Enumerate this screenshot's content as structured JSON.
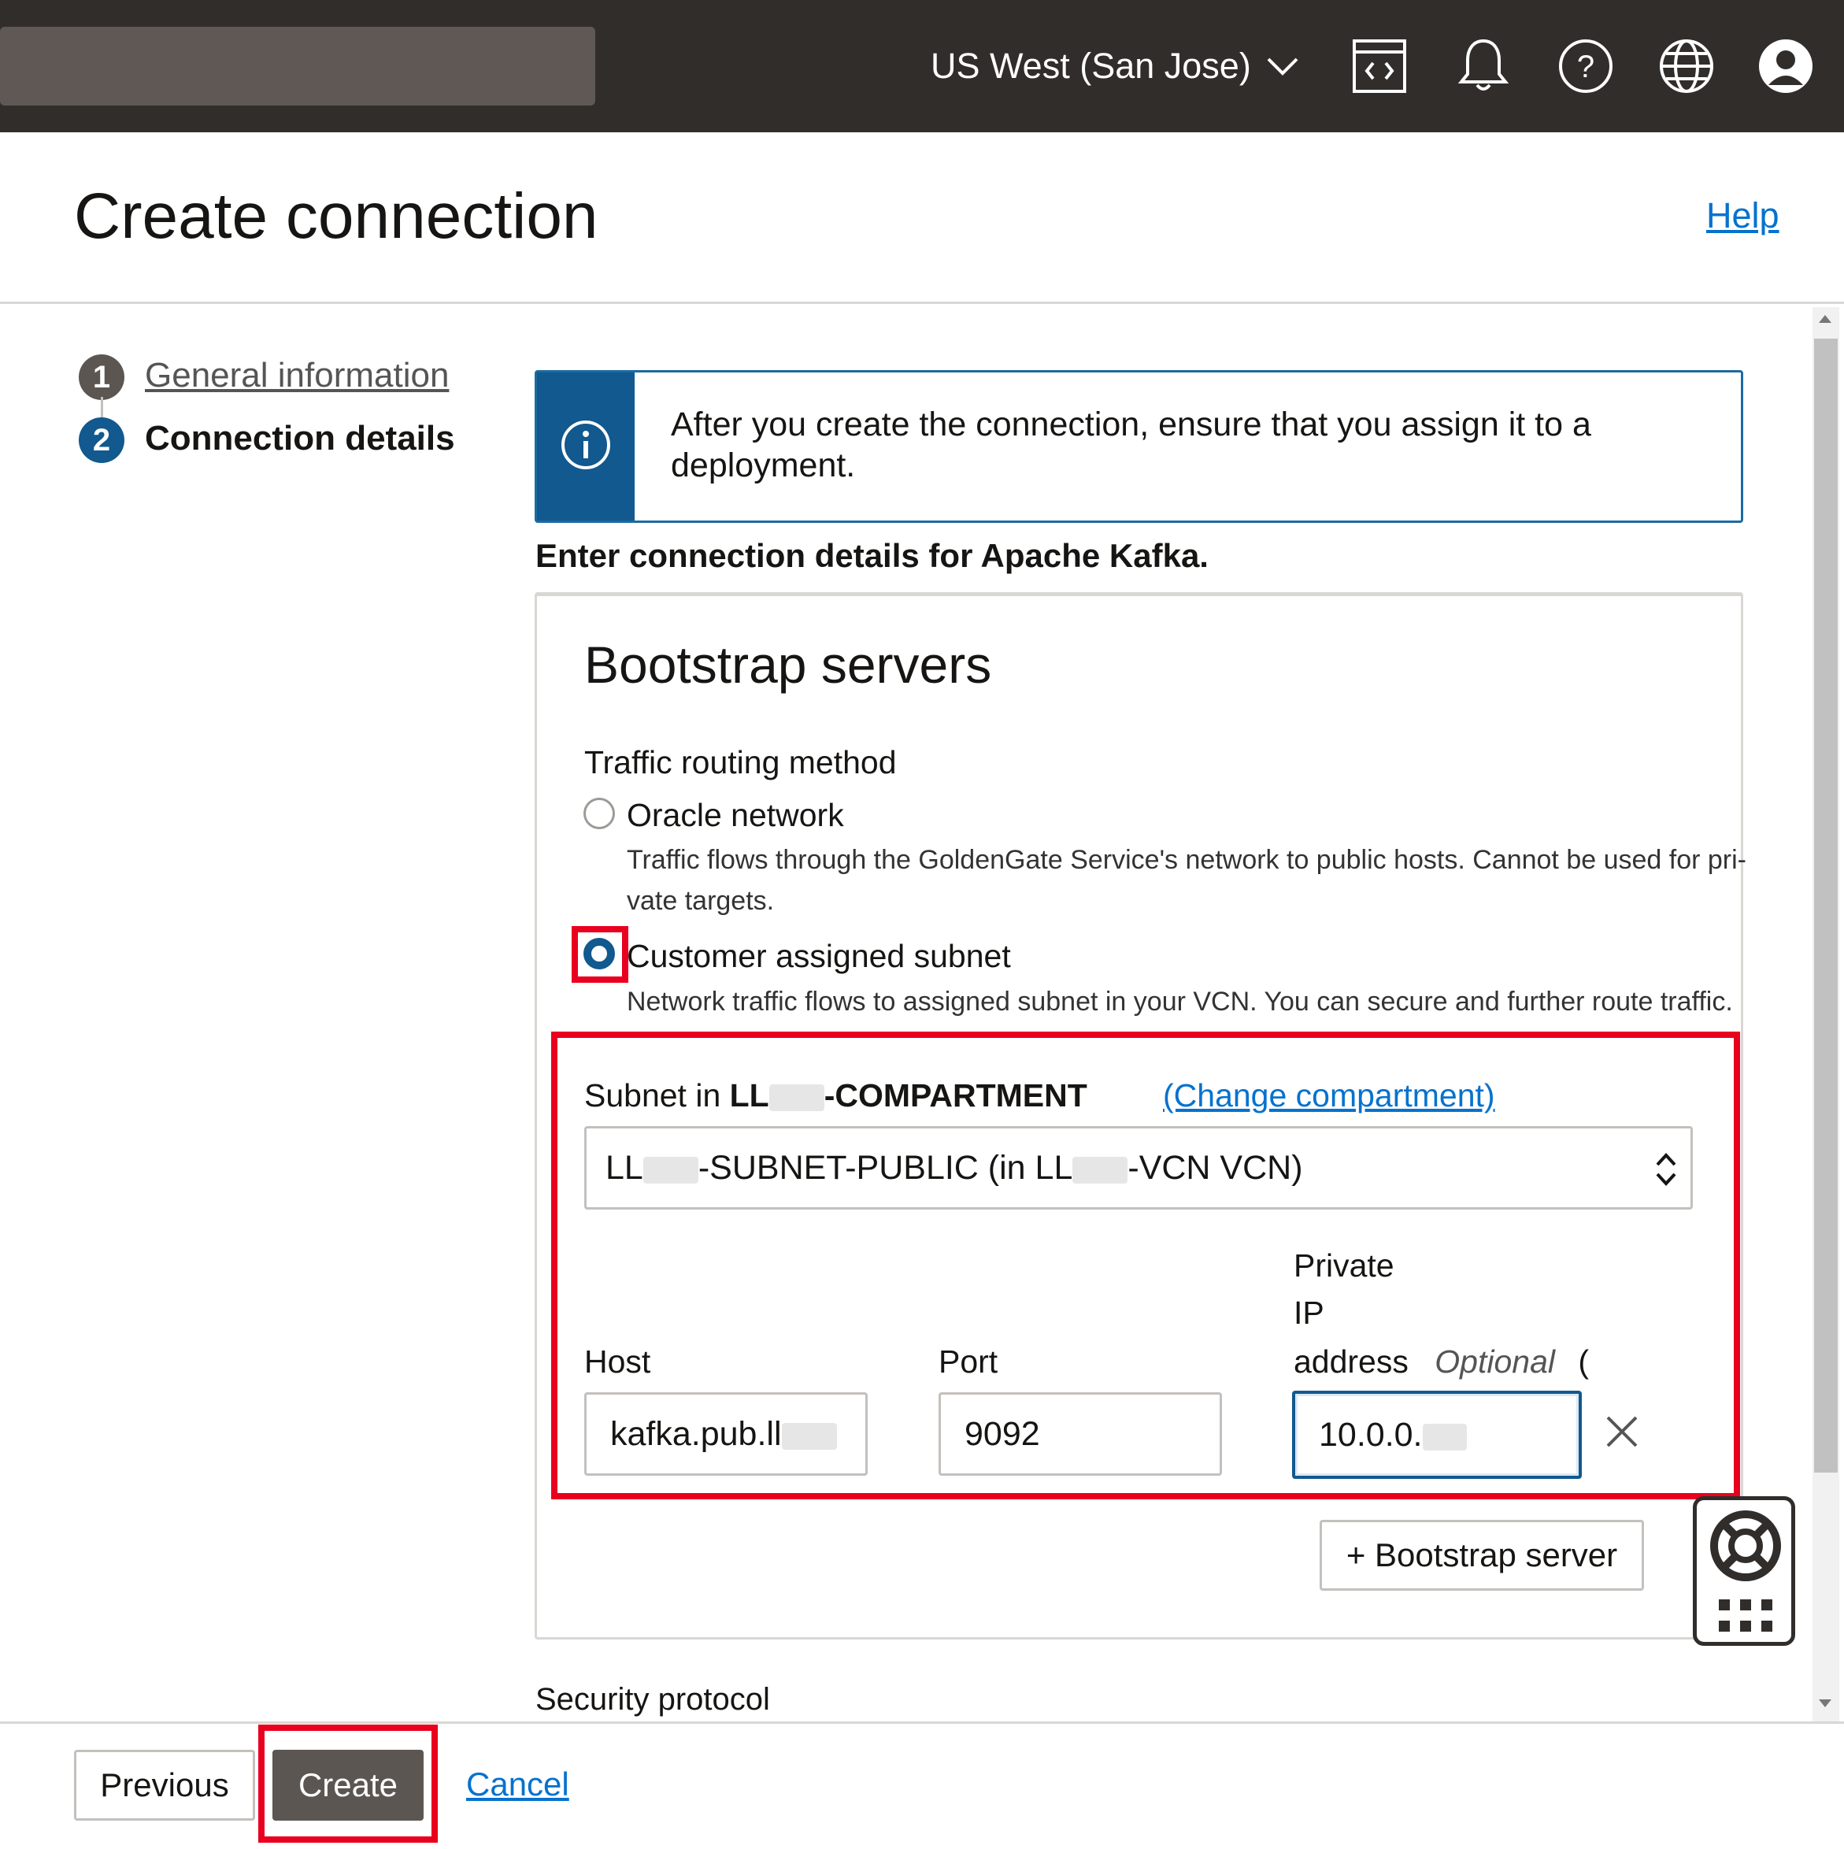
{
  "topbar": {
    "region_label": "US West (San Jose)",
    "icons": [
      "code-editor-icon",
      "bell-icon",
      "help-circle-icon",
      "globe-icon",
      "user-avatar-icon"
    ]
  },
  "header": {
    "title": "Create connection",
    "help_link": "Help"
  },
  "steps": [
    {
      "number": "1",
      "label": "General information"
    },
    {
      "number": "2",
      "label": "Connection details"
    }
  ],
  "info_banner": {
    "text": "After you create the connection, ensure that you assign it to a deployment."
  },
  "section_intro": "Enter connection details for Apache Kafka.",
  "bootstrap": {
    "title": "Bootstrap servers",
    "routing_label": "Traffic routing method",
    "option_oracle": {
      "label": "Oracle network",
      "description_line1": "Traffic flows through the GoldenGate Service's network to public hosts. Cannot be used for pri-",
      "description_line2": "vate targets."
    },
    "option_customer": {
      "label": "Customer assigned subnet",
      "description": "Network traffic flows to assigned subnet in your VCN. You can secure and further route traffic."
    },
    "selected_option": "Customer assigned subnet",
    "subnet_label_prefix": "Subnet in ",
    "subnet_compartment_start": "LL",
    "subnet_compartment_end": "-COMPARTMENT",
    "change_compartment": "(Change compartment)",
    "subnet_select_start": "LL",
    "subnet_select_mid": "-SUBNET-PUBLIC (in LL",
    "subnet_select_end": "-VCN VCN)",
    "host_label": "Host",
    "host_value": "kafka.pub.ll",
    "port_label": "Port",
    "port_value": "9092",
    "private_ip_label_1": "Private",
    "private_ip_label_2": "IP",
    "private_ip_label_3": "address",
    "optional_label": "Optional",
    "optional_paren": "(",
    "private_ip_value": "10.0.0.",
    "add_bootstrap_button": "+ Bootstrap server"
  },
  "security_protocol_label": "Security protocol",
  "footer": {
    "previous": "Previous",
    "create": "Create",
    "cancel": "Cancel"
  },
  "colors": {
    "topbar": "#312d2a",
    "accent": "#11598e",
    "link": "#0572ce",
    "highlight": "#e8001e",
    "primary_button": "#5c5653"
  }
}
